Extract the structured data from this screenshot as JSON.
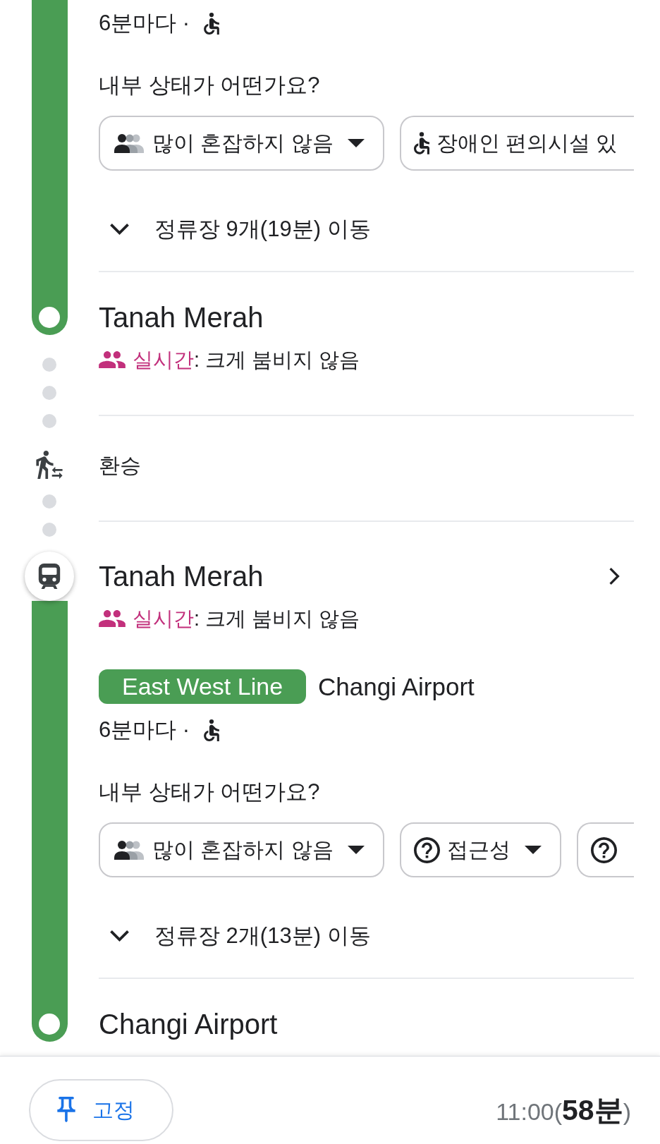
{
  "timeline": [
    {
      "kind": "leg",
      "color": "#4a9d54",
      "frequency": "6분마다 ·",
      "wheelchair_accessible": true,
      "question": "내부 상태가 어떤가요?",
      "chips": [
        {
          "kind": "crowd",
          "label": "많이 혼잡하지 않음",
          "dropdown": true
        },
        {
          "kind": "wheelchair",
          "label": "장애인 편의시설 있"
        }
      ],
      "stops_toggle": {
        "label": "정류장 9개(19분) 이동",
        "expanded": false
      },
      "arrival": {
        "name": "Tanah Merah",
        "crowding": {
          "label": "실시간",
          "status": ": 크게 붐비지 않음"
        }
      }
    },
    {
      "kind": "transfer",
      "label": "환승"
    },
    {
      "kind": "leg",
      "color": "#4a9d54",
      "departure": {
        "name": "Tanah Merah",
        "details_arrow": true,
        "crowding": {
          "label": "실시간",
          "status": ": 크게 붐비지 않음"
        }
      },
      "line": {
        "name": "East West Line",
        "headsign": "Changi Airport"
      },
      "frequency": "6분마다 ·",
      "wheelchair_accessible": true,
      "question": "내부 상태가 어떤가요?",
      "chips": [
        {
          "kind": "crowd",
          "label": "많이 혼잡하지 않음",
          "dropdown": true
        },
        {
          "kind": "help",
          "label": "접근성",
          "dropdown": true
        },
        {
          "kind": "help"
        }
      ],
      "stops_toggle": {
        "label": "정류장 2개(13분) 이동",
        "expanded": false
      },
      "arrival": {
        "name": "Changi Airport"
      }
    }
  ],
  "footer": {
    "pin_button": "고정",
    "arrival_time": "11:00(**58분**)"
  }
}
